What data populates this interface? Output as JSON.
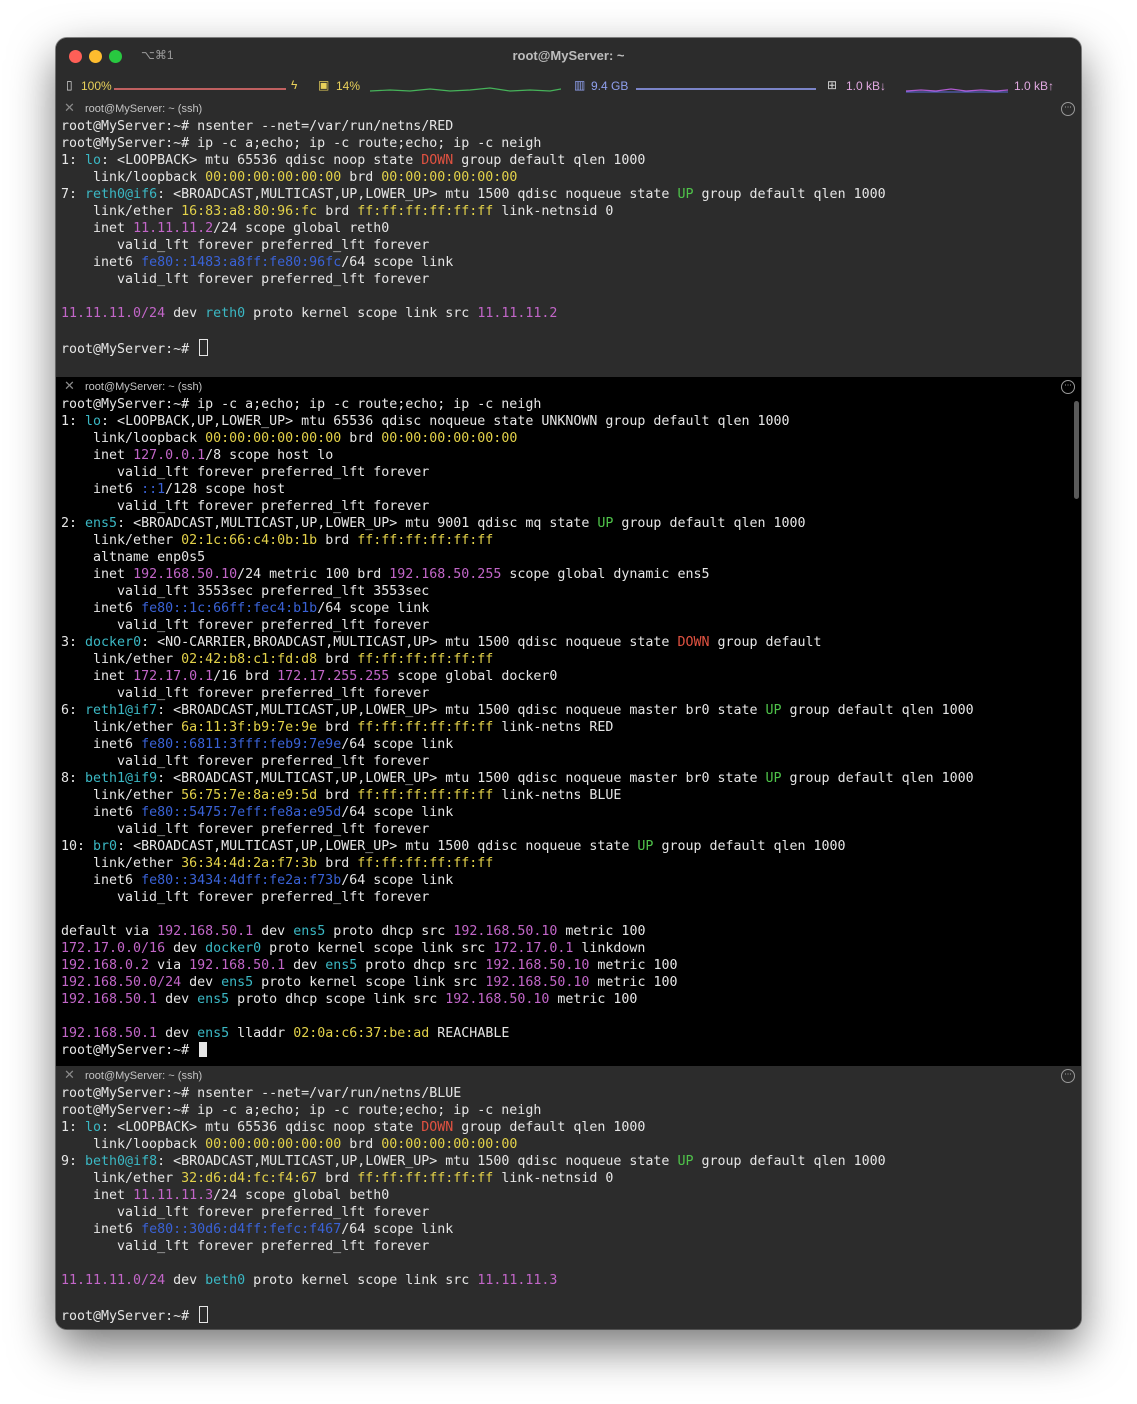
{
  "window": {
    "shortcut": "⌥⌘1",
    "title": "root@MyServer: ~"
  },
  "status": {
    "battery": "100%",
    "cpu": "14%",
    "memory": "9.4 GB",
    "net_down": "1.0 kB↓",
    "net_up": "1.0 kB↑"
  },
  "panes": [
    {
      "title": "root@MyServer: ~ (ssh)",
      "bg": "#2c2c2c",
      "cursor": "hollow",
      "lines": [
        [
          [
            "root@MyServer:~# nsenter --net=/var/run/netns/RED",
            "w"
          ]
        ],
        [
          [
            "root@MyServer:~# ip -c a;echo; ip -c route;echo; ip -c neigh",
            "w"
          ]
        ],
        [
          [
            "1: ",
            "w"
          ],
          [
            "lo",
            "c"
          ],
          [
            ": <LOOPBACK> mtu 65536 qdisc noop state ",
            "w"
          ],
          [
            "DOWN",
            "r"
          ],
          [
            " group default qlen 1000",
            "w"
          ]
        ],
        [
          [
            "    link/loopback ",
            "w"
          ],
          [
            "00:00:00:00:00:00",
            "y"
          ],
          [
            " brd ",
            "w"
          ],
          [
            "00:00:00:00:00:00",
            "y"
          ]
        ],
        [
          [
            "7: ",
            "w"
          ],
          [
            "reth0@if6",
            "c"
          ],
          [
            ": <BROADCAST,MULTICAST,UP,LOWER_UP> mtu 1500 qdisc noqueue state ",
            "w"
          ],
          [
            "UP",
            "g"
          ],
          [
            " group default qlen 1000",
            "w"
          ]
        ],
        [
          [
            "    link/ether ",
            "w"
          ],
          [
            "16:83:a8:80:96:fc",
            "y"
          ],
          [
            " brd ",
            "w"
          ],
          [
            "ff:ff:ff:ff:ff:ff",
            "y"
          ],
          [
            " link-netnsid 0",
            "w"
          ]
        ],
        [
          [
            "    inet ",
            "w"
          ],
          [
            "11.11.11.2",
            "m"
          ],
          [
            "/24 scope global reth0",
            "w"
          ]
        ],
        [
          [
            "       valid_lft forever preferred_lft forever",
            "w"
          ]
        ],
        [
          [
            "    inet6 ",
            "w"
          ],
          [
            "fe80::1483:a8ff:fe80:96fc",
            "b"
          ],
          [
            "/64 scope link",
            "w"
          ]
        ],
        [
          [
            "       valid_lft forever preferred_lft forever",
            "w"
          ]
        ],
        [
          [
            "",
            "w"
          ]
        ],
        [
          [
            "11.11.11.0/24",
            "m"
          ],
          [
            " dev ",
            "w"
          ],
          [
            "reth0",
            "c"
          ],
          [
            " proto kernel scope link src ",
            "w"
          ],
          [
            "11.11.11.2",
            "m"
          ]
        ],
        [
          [
            "",
            "w"
          ]
        ],
        [
          [
            "root@MyServer:~# ",
            "w"
          ]
        ]
      ]
    },
    {
      "title": "root@MyServer: ~ (ssh)",
      "bg": "#000000",
      "cursor": "solid",
      "lines": [
        [
          [
            "root@MyServer:~# ip -c a;echo; ip -c route;echo; ip -c neigh",
            "w"
          ]
        ],
        [
          [
            "1: ",
            "w"
          ],
          [
            "lo",
            "c"
          ],
          [
            ": <LOOPBACK,UP,LOWER_UP> mtu 65536 qdisc noqueue state UNKNOWN group default qlen 1000",
            "w"
          ]
        ],
        [
          [
            "    link/loopback ",
            "w"
          ],
          [
            "00:00:00:00:00:00",
            "y"
          ],
          [
            " brd ",
            "w"
          ],
          [
            "00:00:00:00:00:00",
            "y"
          ]
        ],
        [
          [
            "    inet ",
            "w"
          ],
          [
            "127.0.0.1",
            "m"
          ],
          [
            "/8 scope host lo",
            "w"
          ]
        ],
        [
          [
            "       valid_lft forever preferred_lft forever",
            "w"
          ]
        ],
        [
          [
            "    inet6 ",
            "w"
          ],
          [
            "::1",
            "b"
          ],
          [
            "/128 scope host",
            "w"
          ]
        ],
        [
          [
            "       valid_lft forever preferred_lft forever",
            "w"
          ]
        ],
        [
          [
            "2: ",
            "w"
          ],
          [
            "ens5",
            "c"
          ],
          [
            ": <BROADCAST,MULTICAST,UP,LOWER_UP> mtu 9001 qdisc mq state ",
            "w"
          ],
          [
            "UP",
            "g"
          ],
          [
            " group default qlen 1000",
            "w"
          ]
        ],
        [
          [
            "    link/ether ",
            "w"
          ],
          [
            "02:1c:66:c4:0b:1b",
            "y"
          ],
          [
            " brd ",
            "w"
          ],
          [
            "ff:ff:ff:ff:ff:ff",
            "y"
          ]
        ],
        [
          [
            "    altname enp0s5",
            "w"
          ]
        ],
        [
          [
            "    inet ",
            "w"
          ],
          [
            "192.168.50.10",
            "m"
          ],
          [
            "/24 metric 100 brd ",
            "w"
          ],
          [
            "192.168.50.255",
            "m"
          ],
          [
            " scope global dynamic ens5",
            "w"
          ]
        ],
        [
          [
            "       valid_lft 3553sec preferred_lft 3553sec",
            "w"
          ]
        ],
        [
          [
            "    inet6 ",
            "w"
          ],
          [
            "fe80::1c:66ff:fec4:b1b",
            "b"
          ],
          [
            "/64 scope link",
            "w"
          ]
        ],
        [
          [
            "       valid_lft forever preferred_lft forever",
            "w"
          ]
        ],
        [
          [
            "3: ",
            "w"
          ],
          [
            "docker0",
            "c"
          ],
          [
            ": <NO-CARRIER,BROADCAST,MULTICAST,UP> mtu 1500 qdisc noqueue state ",
            "w"
          ],
          [
            "DOWN",
            "r"
          ],
          [
            " group default",
            "w"
          ]
        ],
        [
          [
            "    link/ether ",
            "w"
          ],
          [
            "02:42:b8:c1:fd:d8",
            "y"
          ],
          [
            " brd ",
            "w"
          ],
          [
            "ff:ff:ff:ff:ff:ff",
            "y"
          ]
        ],
        [
          [
            "    inet ",
            "w"
          ],
          [
            "172.17.0.1",
            "m"
          ],
          [
            "/16 brd ",
            "w"
          ],
          [
            "172.17.255.255",
            "m"
          ],
          [
            " scope global docker0",
            "w"
          ]
        ],
        [
          [
            "       valid_lft forever preferred_lft forever",
            "w"
          ]
        ],
        [
          [
            "6: ",
            "w"
          ],
          [
            "reth1@if7",
            "c"
          ],
          [
            ": <BROADCAST,MULTICAST,UP,LOWER_UP> mtu 1500 qdisc noqueue master br0 state ",
            "w"
          ],
          [
            "UP",
            "g"
          ],
          [
            " group default qlen 1000",
            "w"
          ]
        ],
        [
          [
            "    link/ether ",
            "w"
          ],
          [
            "6a:11:3f:b9:7e:9e",
            "y"
          ],
          [
            " brd ",
            "w"
          ],
          [
            "ff:ff:ff:ff:ff:ff",
            "y"
          ],
          [
            " link-netns RED",
            "w"
          ]
        ],
        [
          [
            "    inet6 ",
            "w"
          ],
          [
            "fe80::6811:3fff:feb9:7e9e",
            "b"
          ],
          [
            "/64 scope link",
            "w"
          ]
        ],
        [
          [
            "       valid_lft forever preferred_lft forever",
            "w"
          ]
        ],
        [
          [
            "8: ",
            "w"
          ],
          [
            "beth1@if9",
            "c"
          ],
          [
            ": <BROADCAST,MULTICAST,UP,LOWER_UP> mtu 1500 qdisc noqueue master br0 state ",
            "w"
          ],
          [
            "UP",
            "g"
          ],
          [
            " group default qlen 1000",
            "w"
          ]
        ],
        [
          [
            "    link/ether ",
            "w"
          ],
          [
            "56:75:7e:8a:e9:5d",
            "y"
          ],
          [
            " brd ",
            "w"
          ],
          [
            "ff:ff:ff:ff:ff:ff",
            "y"
          ],
          [
            " link-netns BLUE",
            "w"
          ]
        ],
        [
          [
            "    inet6 ",
            "w"
          ],
          [
            "fe80::5475:7eff:fe8a:e95d",
            "b"
          ],
          [
            "/64 scope link",
            "w"
          ]
        ],
        [
          [
            "       valid_lft forever preferred_lft forever",
            "w"
          ]
        ],
        [
          [
            "10: ",
            "w"
          ],
          [
            "br0",
            "c"
          ],
          [
            ": <BROADCAST,MULTICAST,UP,LOWER_UP> mtu 1500 qdisc noqueue state ",
            "w"
          ],
          [
            "UP",
            "g"
          ],
          [
            " group default qlen 1000",
            "w"
          ]
        ],
        [
          [
            "    link/ether ",
            "w"
          ],
          [
            "36:34:4d:2a:f7:3b",
            "y"
          ],
          [
            " brd ",
            "w"
          ],
          [
            "ff:ff:ff:ff:ff:ff",
            "y"
          ]
        ],
        [
          [
            "    inet6 ",
            "w"
          ],
          [
            "fe80::3434:4dff:fe2a:f73b",
            "b"
          ],
          [
            "/64 scope link",
            "w"
          ]
        ],
        [
          [
            "       valid_lft forever preferred_lft forever",
            "w"
          ]
        ],
        [
          [
            "",
            "w"
          ]
        ],
        [
          [
            "default via ",
            "w"
          ],
          [
            "192.168.50.1",
            "m"
          ],
          [
            " dev ",
            "w"
          ],
          [
            "ens5",
            "c"
          ],
          [
            " proto dhcp src ",
            "w"
          ],
          [
            "192.168.50.10",
            "m"
          ],
          [
            " metric 100",
            "w"
          ]
        ],
        [
          [
            "172.17.0.0/16",
            "m"
          ],
          [
            " dev ",
            "w"
          ],
          [
            "docker0",
            "c"
          ],
          [
            " proto kernel scope link src ",
            "w"
          ],
          [
            "172.17.0.1",
            "m"
          ],
          [
            " linkdown",
            "w"
          ]
        ],
        [
          [
            "192.168.0.2",
            "m"
          ],
          [
            " via ",
            "w"
          ],
          [
            "192.168.50.1",
            "m"
          ],
          [
            " dev ",
            "w"
          ],
          [
            "ens5",
            "c"
          ],
          [
            " proto dhcp src ",
            "w"
          ],
          [
            "192.168.50.10",
            "m"
          ],
          [
            " metric 100",
            "w"
          ]
        ],
        [
          [
            "192.168.50.0/24",
            "m"
          ],
          [
            " dev ",
            "w"
          ],
          [
            "ens5",
            "c"
          ],
          [
            " proto kernel scope link src ",
            "w"
          ],
          [
            "192.168.50.10",
            "m"
          ],
          [
            " metric 100",
            "w"
          ]
        ],
        [
          [
            "192.168.50.1",
            "m"
          ],
          [
            " dev ",
            "w"
          ],
          [
            "ens5",
            "c"
          ],
          [
            " proto dhcp scope link src ",
            "w"
          ],
          [
            "192.168.50.10",
            "m"
          ],
          [
            " metric 100",
            "w"
          ]
        ],
        [
          [
            "",
            "w"
          ]
        ],
        [
          [
            "192.168.50.1",
            "m"
          ],
          [
            " dev ",
            "w"
          ],
          [
            "ens5",
            "c"
          ],
          [
            " lladdr ",
            "w"
          ],
          [
            "02:0a:c6:37:be:ad",
            "y"
          ],
          [
            " REACHABLE",
            "w"
          ]
        ],
        [
          [
            "root@MyServer:~# ",
            "w"
          ]
        ]
      ]
    },
    {
      "title": "root@MyServer: ~ (ssh)",
      "bg": "#2c2c2c",
      "cursor": "hollow",
      "lines": [
        [
          [
            "root@MyServer:~# nsenter --net=/var/run/netns/BLUE",
            "w"
          ]
        ],
        [
          [
            "root@MyServer:~# ip -c a;echo; ip -c route;echo; ip -c neigh",
            "w"
          ]
        ],
        [
          [
            "1: ",
            "w"
          ],
          [
            "lo",
            "c"
          ],
          [
            ": <LOOPBACK> mtu 65536 qdisc noop state ",
            "w"
          ],
          [
            "DOWN",
            "r"
          ],
          [
            " group default qlen 1000",
            "w"
          ]
        ],
        [
          [
            "    link/loopback ",
            "w"
          ],
          [
            "00:00:00:00:00:00",
            "y"
          ],
          [
            " brd ",
            "w"
          ],
          [
            "00:00:00:00:00:00",
            "y"
          ]
        ],
        [
          [
            "9: ",
            "w"
          ],
          [
            "beth0@if8",
            "c"
          ],
          [
            ": <BROADCAST,MULTICAST,UP,LOWER_UP> mtu 1500 qdisc noqueue state ",
            "w"
          ],
          [
            "UP",
            "g"
          ],
          [
            " group default qlen 1000",
            "w"
          ]
        ],
        [
          [
            "    link/ether ",
            "w"
          ],
          [
            "32:d6:d4:fc:f4:67",
            "y"
          ],
          [
            " brd ",
            "w"
          ],
          [
            "ff:ff:ff:ff:ff:ff",
            "y"
          ],
          [
            " link-netnsid 0",
            "w"
          ]
        ],
        [
          [
            "    inet ",
            "w"
          ],
          [
            "11.11.11.3",
            "m"
          ],
          [
            "/24 scope global beth0",
            "w"
          ]
        ],
        [
          [
            "       valid_lft forever preferred_lft forever",
            "w"
          ]
        ],
        [
          [
            "    inet6 ",
            "w"
          ],
          [
            "fe80::30d6:d4ff:fefc:f467",
            "b"
          ],
          [
            "/64 scope link",
            "w"
          ]
        ],
        [
          [
            "       valid_lft forever preferred_lft forever",
            "w"
          ]
        ],
        [
          [
            "",
            "w"
          ]
        ],
        [
          [
            "11.11.11.0/24",
            "m"
          ],
          [
            " dev ",
            "w"
          ],
          [
            "beth0",
            "c"
          ],
          [
            " proto kernel scope link src ",
            "w"
          ],
          [
            "11.11.11.3",
            "m"
          ]
        ],
        [
          [
            "",
            "w"
          ]
        ],
        [
          [
            "root@MyServer:~# ",
            "w"
          ]
        ]
      ]
    }
  ],
  "colors": {
    "w": "#e6e6e6",
    "c": "#3bb8c4",
    "y": "#e3d24a",
    "r": "#e15241",
    "g": "#4fc34a",
    "m": "#c266c8",
    "b": "#3a62d6"
  }
}
